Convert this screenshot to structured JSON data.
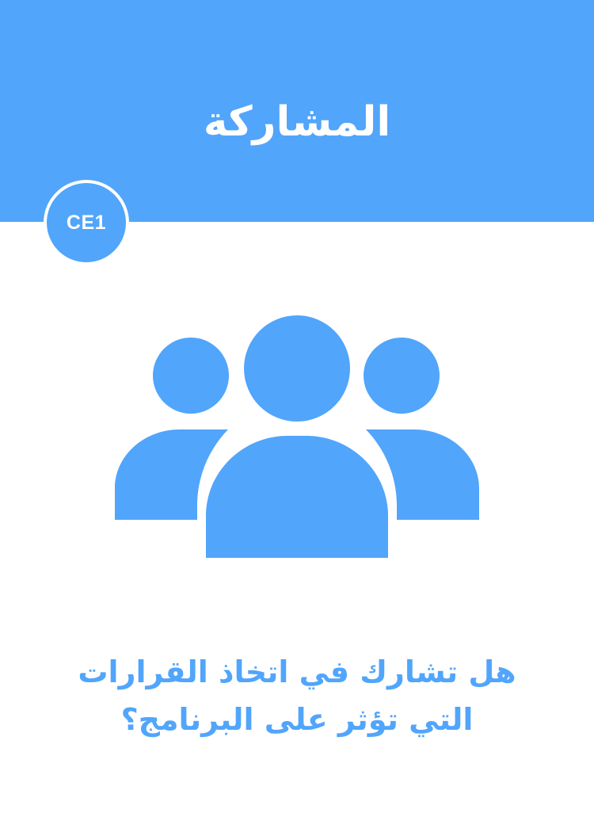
{
  "header": {
    "title": "المشاركة",
    "background_color": "#51a5fb"
  },
  "badge": {
    "label": "CE1"
  },
  "illustration": {
    "icon": "group-of-people-icon",
    "color": "#51a5fb"
  },
  "question": {
    "line1": "هل تشارك في اتخاذ القرارات",
    "line2": "التي تؤثر على البرنامج؟",
    "color": "#51a5fb"
  }
}
